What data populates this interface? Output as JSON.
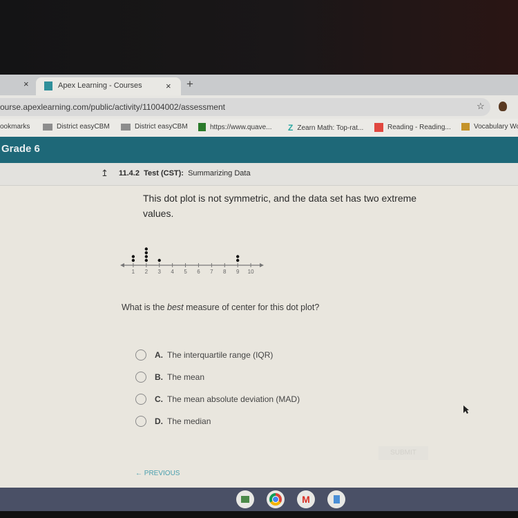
{
  "browser": {
    "tabs": [
      {
        "label": "",
        "active": false
      },
      {
        "label": "Apex Learning - Courses",
        "active": true
      }
    ],
    "tab_close_glyph": "×",
    "new_tab_glyph": "+",
    "url": "ourse.apexlearning.com/public/activity/11004002/assessment",
    "star_glyph": "☆",
    "bookmarks": [
      {
        "label": "ookmarks",
        "icon": "bookmarks-folder"
      },
      {
        "label": "District easyCBM",
        "icon": "easycbm-icon"
      },
      {
        "label": "District easyCBM",
        "icon": "easycbm-icon"
      },
      {
        "label": "https://www.quave...",
        "icon": "quaver-icon"
      },
      {
        "label": "Zearn Math: Top-rat...",
        "icon": "zearn-icon"
      },
      {
        "label": "Reading - Reading...",
        "icon": "reading-icon"
      },
      {
        "label": "Vocabulary Wo",
        "icon": "vocabulary-icon"
      }
    ]
  },
  "course": {
    "title": "Grade 6",
    "lesson_number": "11.4.2",
    "lesson_type": "Test (CST):",
    "lesson_name": "Summarizing Data",
    "up_glyph": "↥"
  },
  "question": {
    "stem": "This dot plot is not symmetric, and the data set has two extreme values.",
    "prompt_before": "What is the ",
    "prompt_emphasis": "best",
    "prompt_after": " measure of center for this dot plot?",
    "choices": [
      {
        "letter": "A.",
        "text": "The interquartile range (IQR)"
      },
      {
        "letter": "B.",
        "text": "The mean"
      },
      {
        "letter": "C.",
        "text": "The mean absolute deviation (MAD)"
      },
      {
        "letter": "D.",
        "text": "The median"
      }
    ],
    "submit_label": "SUBMIT",
    "previous_label": "← PREVIOUS"
  },
  "chart_data": {
    "type": "scatter",
    "subtype": "dot-plot",
    "title": "",
    "xlabel": "",
    "ylabel": "",
    "x_ticks": [
      1,
      2,
      3,
      4,
      5,
      6,
      7,
      8,
      9,
      10
    ],
    "xlim": [
      0,
      11
    ],
    "points": [
      {
        "x": 1,
        "count": 2
      },
      {
        "x": 2,
        "count": 4
      },
      {
        "x": 3,
        "count": 1
      },
      {
        "x": 9,
        "count": 2
      }
    ],
    "colors": {
      "dot": "#111111",
      "axis": "#777777"
    }
  },
  "shelf": {
    "apps": [
      {
        "name": "classroom-icon",
        "color": "#4c8a4a"
      },
      {
        "name": "chrome-icon",
        "color": "#db4437"
      },
      {
        "name": "gmail-icon",
        "color": "#d93025"
      },
      {
        "name": "docs-icon",
        "color": "#4b8fd6"
      }
    ]
  }
}
